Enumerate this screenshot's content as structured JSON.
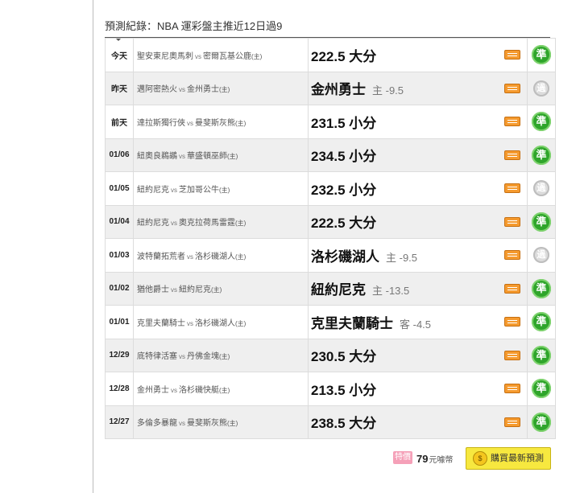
{
  "header": {
    "title": "預測紀錄：NBA 運彩盤主推近12日過9"
  },
  "rows": [
    {
      "date": "今天",
      "away": "聖安東尼奧馬刺",
      "home": "密爾瓦基公鹿",
      "pick": "222.5 大分",
      "side": "",
      "result": "準",
      "result_type": "win"
    },
    {
      "date": "昨天",
      "away": "邁阿密熱火",
      "home": "金州勇士",
      "pick": "金州勇士",
      "side": "主 -9.5",
      "result": "過",
      "result_type": "push"
    },
    {
      "date": "前天",
      "away": "達拉斯獨行俠",
      "home": "曼斐斯灰熊",
      "pick": "231.5 小分",
      "side": "",
      "result": "準",
      "result_type": "win"
    },
    {
      "date": "01/06",
      "away": "紐奧良鵜鶘",
      "home": "華盛頓巫師",
      "pick": "234.5 小分",
      "side": "",
      "result": "準",
      "result_type": "win"
    },
    {
      "date": "01/05",
      "away": "紐約尼克",
      "home": "芝加哥公牛",
      "pick": "232.5 小分",
      "side": "",
      "result": "過",
      "result_type": "push"
    },
    {
      "date": "01/04",
      "away": "紐約尼克",
      "home": "奧克拉荷馬雷霆",
      "pick": "222.5 大分",
      "side": "",
      "result": "準",
      "result_type": "win"
    },
    {
      "date": "01/03",
      "away": "波特蘭拓荒者",
      "home": "洛杉磯湖人",
      "pick": "洛杉磯湖人",
      "side": "主 -9.5",
      "result": "過",
      "result_type": "push"
    },
    {
      "date": "01/02",
      "away": "猶他爵士",
      "home": "紐約尼克",
      "pick": "紐約尼克",
      "side": "主 -13.5",
      "result": "準",
      "result_type": "win"
    },
    {
      "date": "01/01",
      "away": "克里夫蘭騎士",
      "home": "洛杉磯湖人",
      "pick": "克里夫蘭騎士",
      "side": "客 -4.5",
      "result": "準",
      "result_type": "win"
    },
    {
      "date": "12/29",
      "away": "底特律活塞",
      "home": "丹佛金塊",
      "pick": "230.5 大分",
      "side": "",
      "result": "準",
      "result_type": "win"
    },
    {
      "date": "12/28",
      "away": "金州勇士",
      "home": "洛杉磯快艇",
      "pick": "213.5 小分",
      "side": "",
      "result": "準",
      "result_type": "win"
    },
    {
      "date": "12/27",
      "away": "多倫多暴龍",
      "home": "曼斐斯灰熊",
      "pick": "238.5 大分",
      "side": "",
      "result": "準",
      "result_type": "win"
    }
  ],
  "labels": {
    "vs": "vs",
    "host": "(主)"
  },
  "footer": {
    "tag": "特價",
    "price": "79",
    "unit": "元噱幣",
    "buy_label": "購買最新預測",
    "coin_icon_text": "$"
  },
  "colors": {
    "win": "#2fa52b",
    "push": "#dcdcdc",
    "buy_button": "#f7e83f",
    "note_icon": "#f59a2e"
  }
}
